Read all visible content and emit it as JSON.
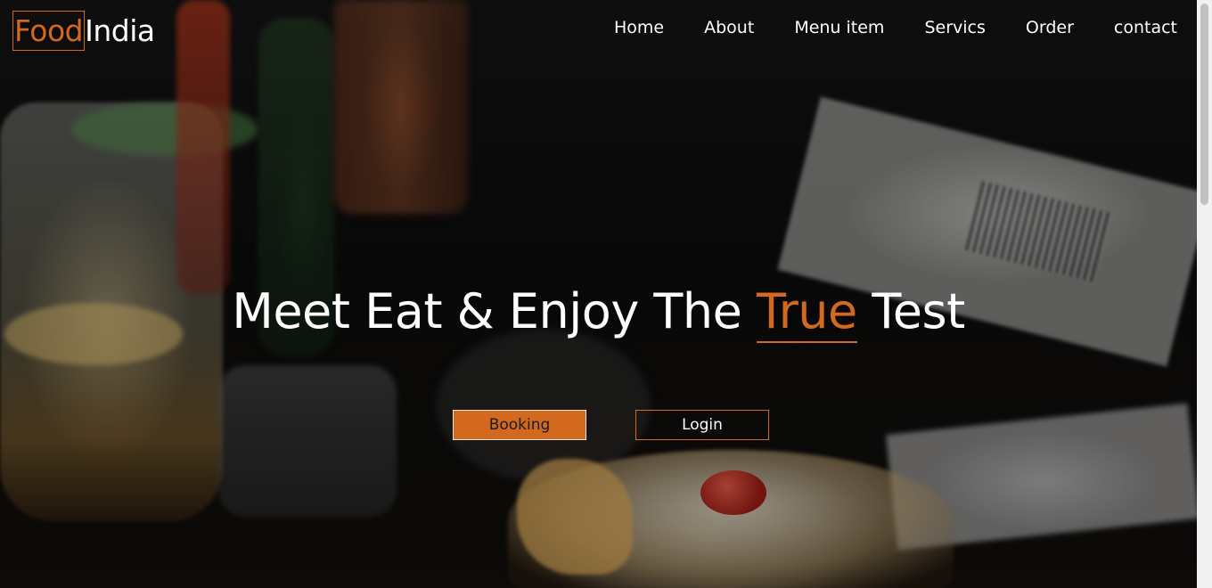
{
  "brand": {
    "part1": "Food",
    "part2": "India",
    "accent_color": "#d2691e"
  },
  "nav": {
    "items": [
      {
        "label": "Home"
      },
      {
        "label": "About"
      },
      {
        "label": "Menu item"
      },
      {
        "label": "Servics"
      },
      {
        "label": "Order"
      },
      {
        "label": "contact"
      }
    ]
  },
  "hero": {
    "headline_before": "Meet Eat & Enjoy The ",
    "headline_accent": "True",
    "headline_after": " Test",
    "background_image": "restaurant-table-photo"
  },
  "buttons": {
    "booking": "Booking",
    "login": "Login"
  }
}
